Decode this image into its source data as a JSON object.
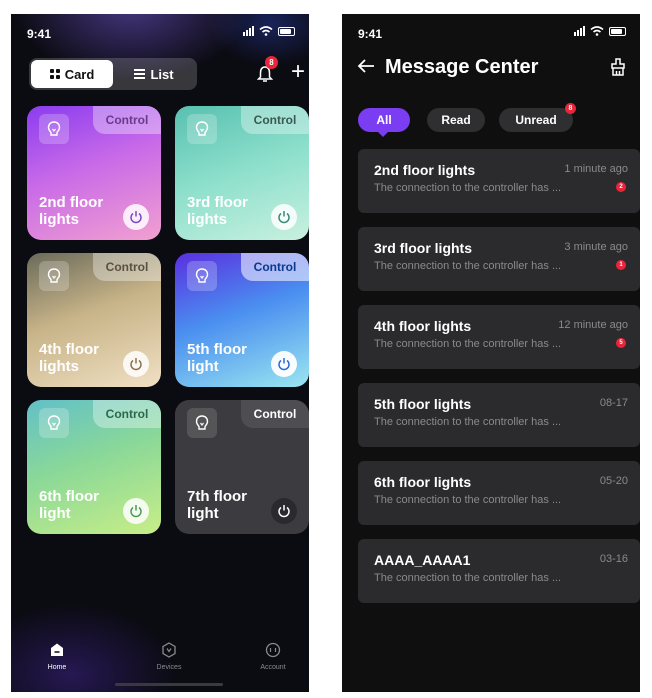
{
  "left": {
    "status_time": "9:41",
    "view_toggle": {
      "card_label": "Card",
      "list_label": "List"
    },
    "notification_count": "8",
    "add_icon": "+",
    "control_label": "Control",
    "cards": [
      {
        "name": "2nd floor lights",
        "power_icon": "power-icon"
      },
      {
        "name": "3rd floor lights",
        "power_icon": "power-icon"
      },
      {
        "name": "4th floor lights",
        "power_icon": "power-icon"
      },
      {
        "name": "5th floor light",
        "power_icon": "power-icon"
      },
      {
        "name": "6th floor light",
        "power_icon": "power-icon"
      },
      {
        "name": "7th floor light",
        "power_icon": "power-icon"
      }
    ],
    "tabs": [
      {
        "label": "Home",
        "icon": "home-icon"
      },
      {
        "label": "Devices",
        "icon": "hexagon-icon"
      },
      {
        "label": "Account",
        "icon": "account-icon"
      }
    ]
  },
  "right": {
    "status_time": "9:41",
    "title": "Message Center",
    "filters": {
      "all": "All",
      "read": "Read",
      "unread": "Unread",
      "unread_badge": "8"
    },
    "messages": [
      {
        "title": "2nd floor lights",
        "time": "1 minute ago",
        "body": "The connection to the controller has ...",
        "badge": "2"
      },
      {
        "title": "3rd floor lights",
        "time": "3 minute ago",
        "body": "The connection to the controller has ...",
        "badge": "1"
      },
      {
        "title": "4th floor lights",
        "time": "12 minute ago",
        "body": "The connection to the controller has ...",
        "badge": "5"
      },
      {
        "title": "5th floor lights",
        "time": "08-17",
        "body": "The connection to the controller has ..."
      },
      {
        "title": "6th floor lights",
        "time": "05-20",
        "body": "The connection to the controller has ..."
      },
      {
        "title": "AAAA_AAAA1",
        "time": "03-16",
        "body": "The connection to the controller has ..."
      }
    ]
  },
  "colors": {
    "accent": "#7b3df2",
    "badge": "#e8253a",
    "card_bg": "#2b2b2d"
  }
}
